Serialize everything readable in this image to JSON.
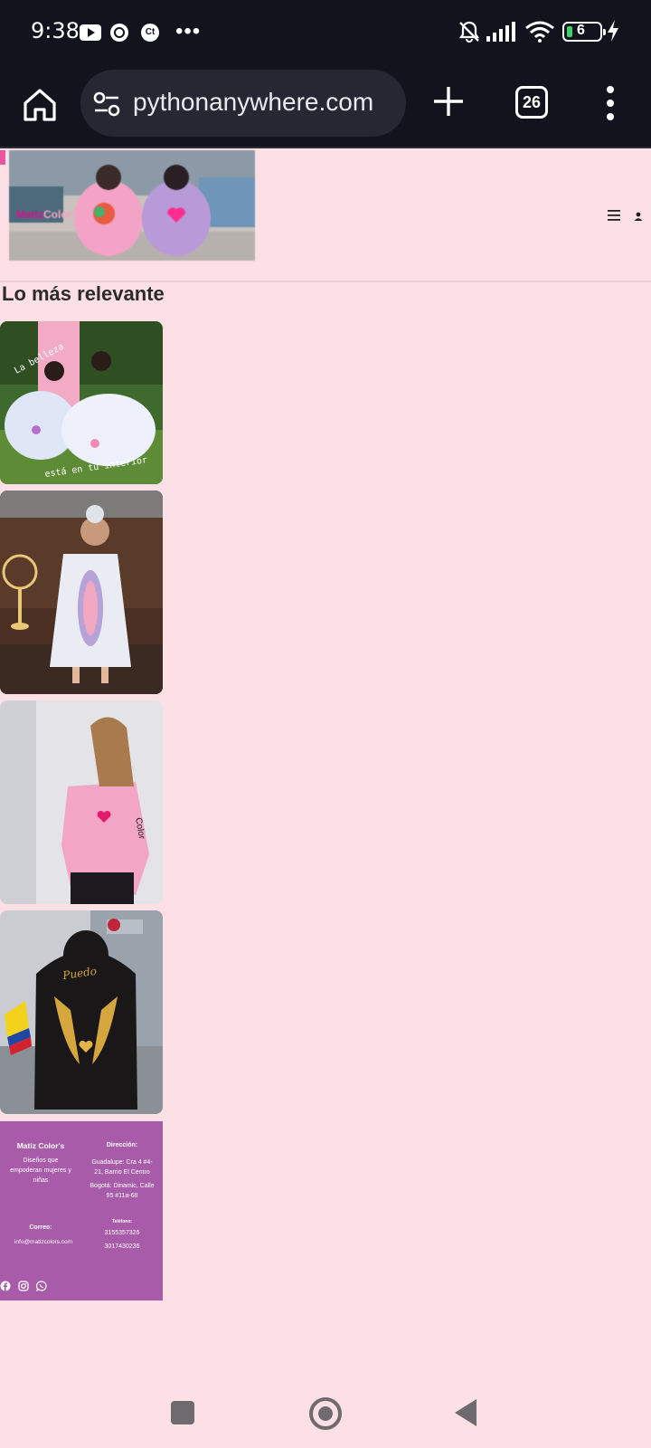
{
  "status_bar": {
    "time": "9:38",
    "battery_level": "6",
    "icons": [
      "youtube-icon",
      "chrome-icon",
      "ct-icon",
      "more-dots-icon",
      "bell-off-icon",
      "signal-icon",
      "wifi-icon",
      "battery-icon",
      "charging-icon"
    ],
    "ct_label": "Ct"
  },
  "browser": {
    "url": "pythonanywhere.com",
    "tab_count": "26"
  },
  "site": {
    "logo_part1": "Matiz",
    "logo_part2": "Color's",
    "section_title": "Lo más relevante",
    "products": [
      {
        "overlay_top": "La belleza",
        "overlay_bottom": "está en tu interior"
      },
      {
        "overlay_top": "",
        "overlay_bottom": ""
      },
      {
        "overlay_top": "",
        "overlay_bottom": ""
      },
      {
        "overlay_top": "Puedo",
        "overlay_bottom": ""
      }
    ]
  },
  "footer": {
    "brand": "Matiz Color's",
    "tagline": "Diseños que empoderan mujeres y niñas",
    "address_label": "Dirección:",
    "address_1": "Guadalupe: Cra 4 #4-21, Barrio El Centro",
    "address_2": "Bogotá: Dinamic, Calle 95 #11a-68",
    "email_label": "Correo:",
    "email": "info@matizcolors.com",
    "phone_label": "Teléfono:",
    "phone_1": "3155357326",
    "phone_2": "3017430236",
    "social": [
      "facebook-icon",
      "instagram-icon",
      "whatsapp-icon"
    ]
  },
  "colors": {
    "page_bg": "#fde0e6",
    "footer_bg": "#a75ba8",
    "brand_pink": "#d7158a",
    "chrome_bar": "#11141c"
  }
}
